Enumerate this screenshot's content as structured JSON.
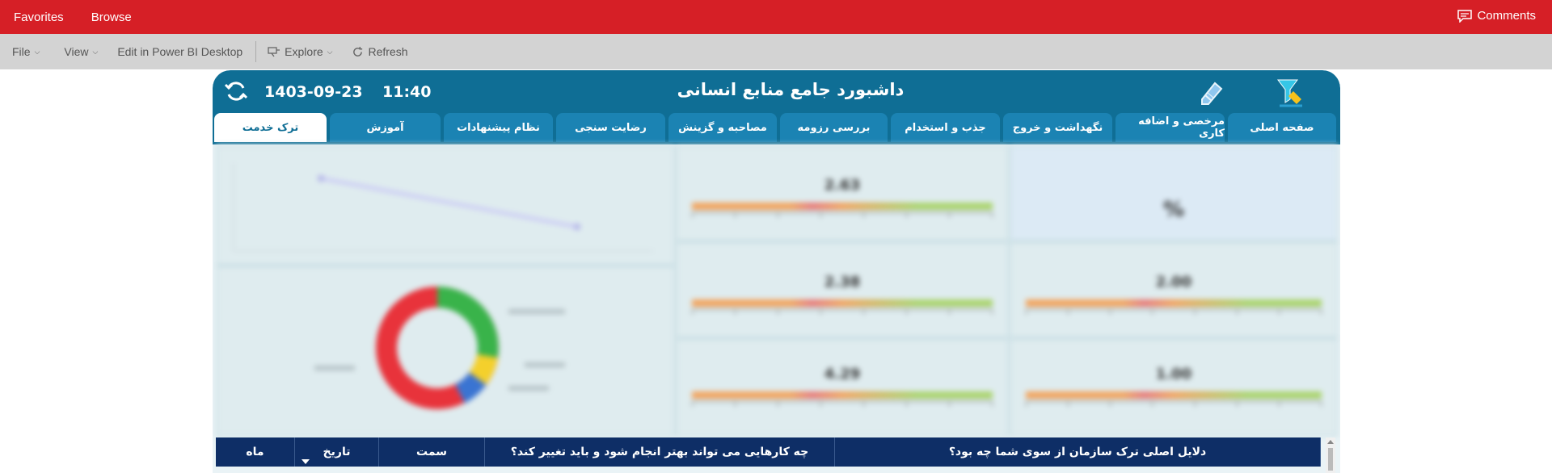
{
  "topbar": {
    "favorites_label": "Favorites",
    "browse_label": "Browse",
    "comments_label": "Comments",
    "bg_color": "#d61f26"
  },
  "toolbar": {
    "file_label": "File",
    "view_label": "View",
    "edit_label": "Edit in Power BI Desktop",
    "explore_label": "Explore",
    "refresh_label": "Refresh"
  },
  "dashboard": {
    "title": "داشبورد جامع منابع انسانی",
    "date": "1403-09-23",
    "time": "11:40",
    "header_color": "#0f6e95",
    "tabs": [
      {
        "label": "صفحه اصلی"
      },
      {
        "label": "مرخصی و اضافه کاری"
      },
      {
        "label": "نگهداشت و خروج"
      },
      {
        "label": "جذب و استخدام"
      },
      {
        "label": "بررسی رزومه"
      },
      {
        "label": "مصاحبه و گزینش"
      },
      {
        "label": "رضایت سنجی"
      },
      {
        "label": "نظام پیشنهادات"
      },
      {
        "label": "آموزش"
      },
      {
        "label": "ترک خدمت"
      }
    ],
    "active_tab": "ترک خدمت",
    "panels": {
      "kpi_main_value": "%",
      "gauge_1_value": "2.63",
      "gauge_2_value": "2.38",
      "gauge_3_value": "4.29",
      "gauge_4_value": "2.00",
      "gauge_5_value": "1.00"
    }
  },
  "table": {
    "columns": [
      {
        "label": "ماه"
      },
      {
        "label": "تاریخ"
      },
      {
        "label": "سمت"
      },
      {
        "label": "چه کارهایی می تواند بهتر انجام شود و باید تغییر کند؟"
      },
      {
        "label": "دلایل اصلی ترک سازمان از سوی شما چه بود؟"
      }
    ],
    "header_color": "#0e2e66"
  }
}
